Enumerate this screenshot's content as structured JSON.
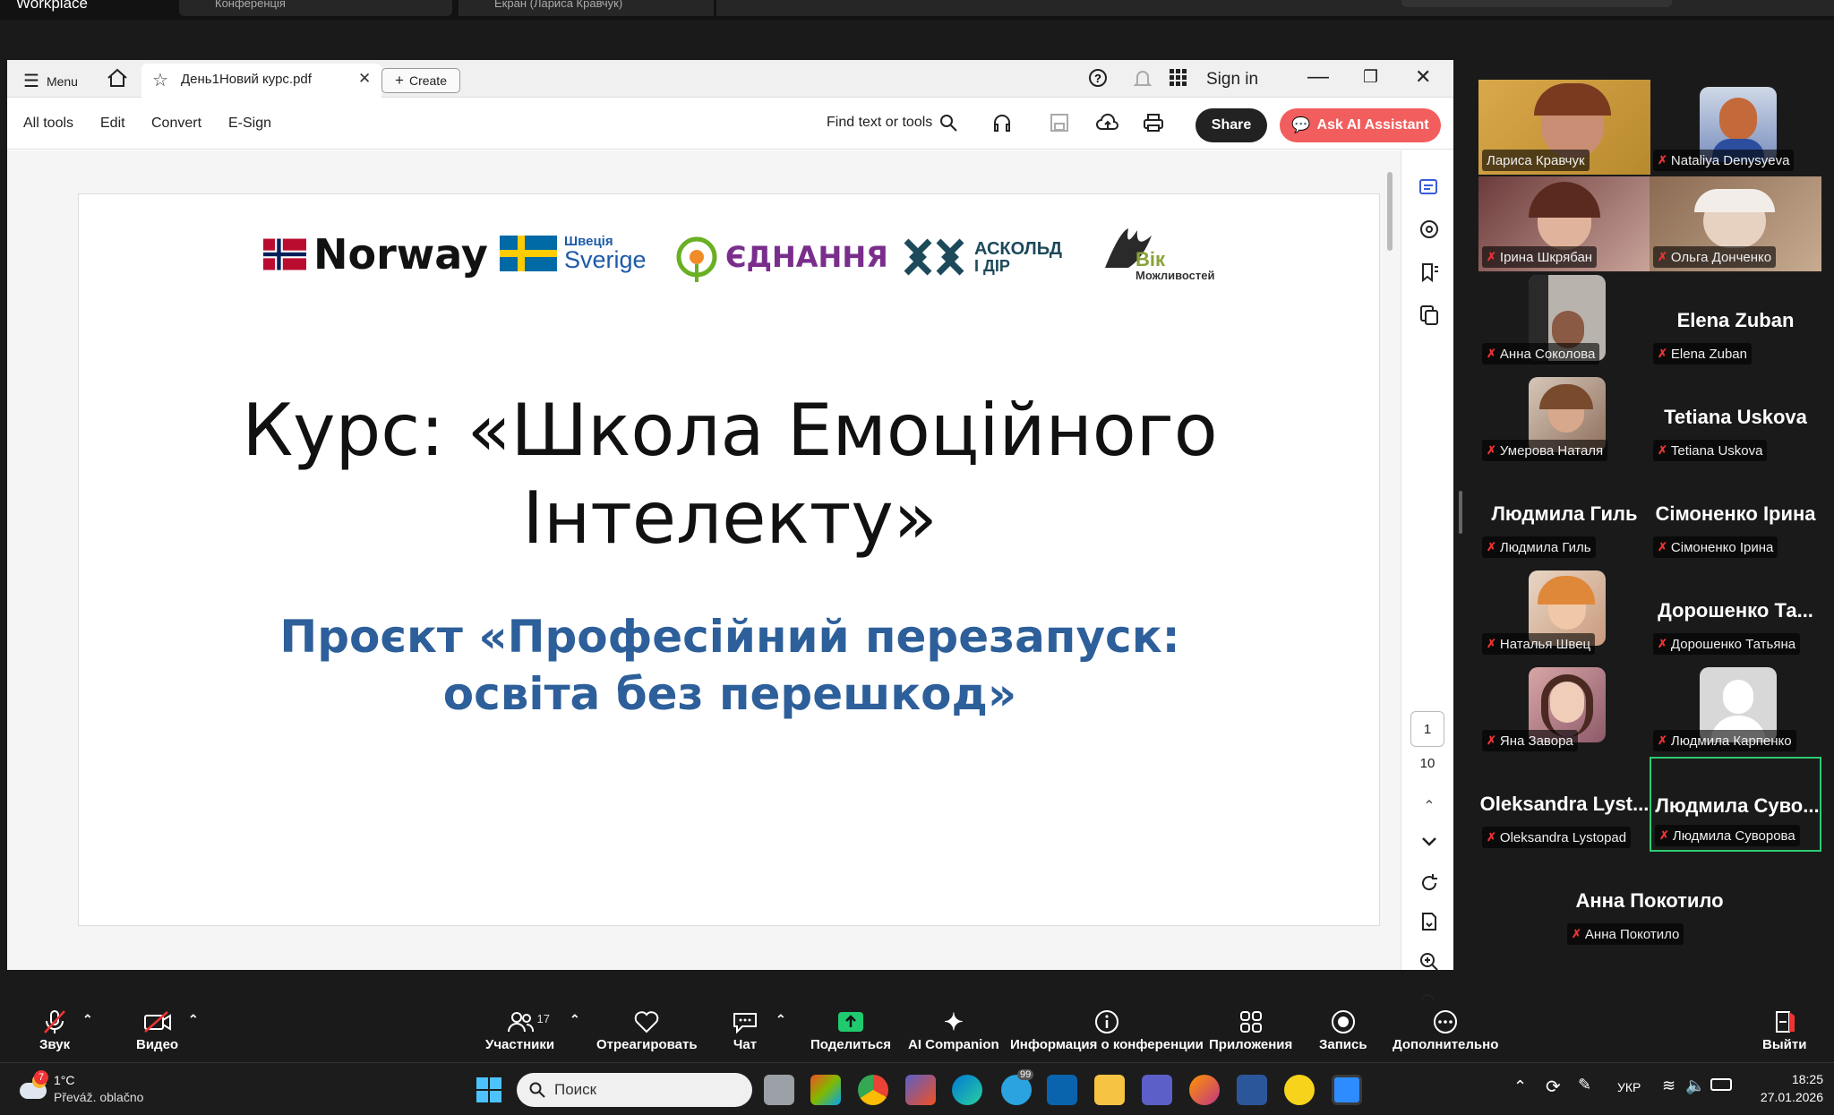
{
  "top_strip": {
    "title": "Workplace",
    "tab1": "Конференція",
    "tab2": "Екран (Лариса Кравчук)"
  },
  "acrobat": {
    "menu_label": "Menu",
    "doc_tab": "День1Новий курс.pdf",
    "create_label": "Create",
    "sign_in": "Sign in",
    "toolbar": {
      "all_tools": "All tools",
      "edit": "Edit",
      "convert": "Convert",
      "esign": "E-Sign",
      "find": "Find text or tools",
      "share": "Share",
      "ai": "Ask AI Assistant"
    },
    "page_current": "1",
    "page_total": "10"
  },
  "slide": {
    "logos": {
      "norway": "Norway",
      "sweden_top": "Швеція",
      "sweden_bottom": "Sverige",
      "ednannia": "ЄДНАННЯ",
      "askold_top": "АСКОЛЬД",
      "askold_bottom": "І ДІР",
      "vik_top": "Вік",
      "vik_bottom": "Можливостей"
    },
    "title_line1": "Курс: «Школа Емоційного",
    "title_line2": "Інтелекту»",
    "subtitle_line1": "Проєкт «Професійний перезапуск:",
    "subtitle_line2": "освіта без перешкод»"
  },
  "participants": [
    {
      "label": "Лариса Кравчук",
      "display": "",
      "muted": false
    },
    {
      "label": "Nataliya Denysyeva",
      "display": "",
      "muted": true
    },
    {
      "label": "Ірина Шкрябан",
      "display": "",
      "muted": true
    },
    {
      "label": "Ольга Донченко",
      "display": "",
      "muted": true
    },
    {
      "label": "Анна Соколова",
      "display": "",
      "muted": true
    },
    {
      "label": "Elena Zuban",
      "display": "Elena Zuban",
      "muted": true
    },
    {
      "label": "Умерова Наталя",
      "display": "",
      "muted": true
    },
    {
      "label": "Tetiana Uskova",
      "display": "Tetiana Uskova",
      "muted": true
    },
    {
      "label": "Людмила Гиль",
      "display": "Людмила Гиль",
      "muted": true
    },
    {
      "label": "Сімоненко Ірина",
      "display": "Сімоненко Ірина",
      "muted": true
    },
    {
      "label": "Наталья Швец",
      "display": "",
      "muted": true
    },
    {
      "label": "Дорошенко Татьяна",
      "display": "Дорошенко Та...",
      "muted": true
    },
    {
      "label": "Яна Завора",
      "display": "",
      "muted": true
    },
    {
      "label": "Людмила Карпенко",
      "display": "",
      "muted": true
    },
    {
      "label": "Oleksandra Lystopad",
      "display": "Oleksandra Lyst...",
      "muted": true
    },
    {
      "label": "Людмила Суворова",
      "display": "Людмила Суво...",
      "muted": true
    },
    {
      "label": "Анна Покотило",
      "display": "Анна Покотило",
      "muted": true
    }
  ],
  "zoom_bar": {
    "audio": "Звук",
    "video": "Видео",
    "participants": "Участники",
    "participants_count": "17",
    "react": "Отреагировать",
    "chat": "Чат",
    "share": "Поделиться",
    "ai": "AI Companion",
    "info": "Информация о конференции",
    "apps": "Приложения",
    "record": "Запись",
    "more": "Дополнительно",
    "leave": "Выйти"
  },
  "taskbar": {
    "weather_temp": "1°C",
    "weather_desc": "Převáž. oblačno",
    "weather_badge": "7",
    "search": "Поиск",
    "lang": "УКР",
    "time": "18:25",
    "date": "27.01.2026",
    "badge": "99"
  },
  "colors": {
    "ai_button": "#f25d5d",
    "subtitle": "#2d5f9a",
    "active_speaker": "#2ecc71"
  }
}
